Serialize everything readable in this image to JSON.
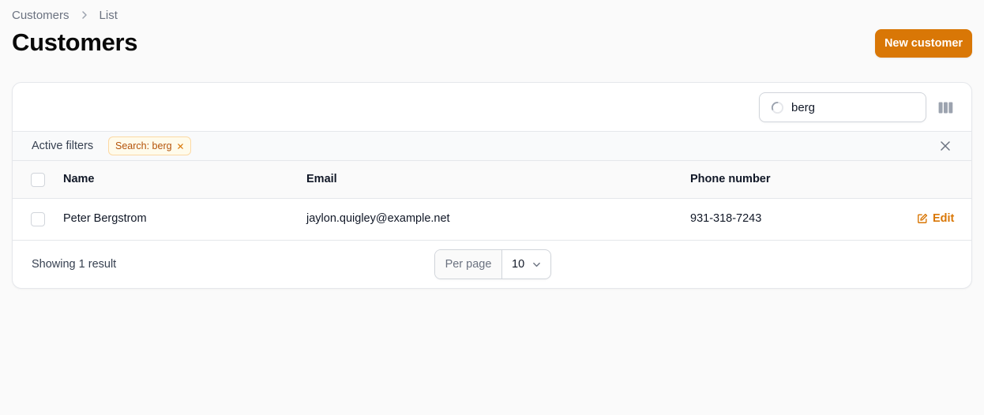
{
  "breadcrumb": {
    "items": [
      "Customers",
      "List"
    ]
  },
  "header": {
    "title": "Customers",
    "new_button_label": "New customer"
  },
  "toolbar": {
    "search_value": "berg",
    "search_icon": "loading-spinner-icon",
    "columns_icon": "columns-icon"
  },
  "filters": {
    "label": "Active filters",
    "badges": [
      "Search: berg"
    ]
  },
  "table": {
    "columns": [
      "Name",
      "Email",
      "Phone number"
    ],
    "rows": [
      {
        "name": "Peter Bergstrom",
        "email": "jaylon.quigley@example.net",
        "phone": "931-318-7243",
        "action": "Edit"
      }
    ]
  },
  "footer": {
    "result_text": "Showing 1 result",
    "per_page_label": "Per page",
    "per_page_value": "10"
  },
  "colors": {
    "accent": "#d97706",
    "badge_text": "#b45309",
    "badge_bg": "#fffbeb"
  }
}
